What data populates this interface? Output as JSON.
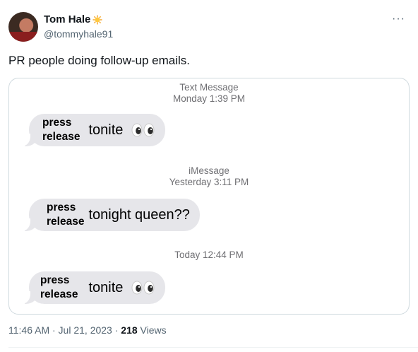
{
  "tweet": {
    "author": {
      "display_name": "Tom Hale",
      "badge_icon": "sun-emoji-icon",
      "handle": "@tommyhale91"
    },
    "more_icon": "more-options-icon",
    "text": "PR people doing follow-up emails.",
    "timestamp": "11:46 AM · Jul 21, 2023 · ",
    "views_count": "218",
    "views_label": " Views"
  },
  "screenshot": {
    "header_top": {
      "line1": "Text Message",
      "line2": "Monday 1:39 PM"
    },
    "header_middle": {
      "line1": "iMessage",
      "line2": "Yesterday 3:11 PM"
    },
    "header_bottom": {
      "line1": "Today 12:44 PM"
    },
    "messages": [
      {
        "sticker_line1": "press",
        "sticker_line2": "release",
        "text": "tonite",
        "emoji": "eyes-emoji-icon"
      },
      {
        "sticker_line1": "press",
        "sticker_line2": "release",
        "text": "tonight queen??"
      },
      {
        "sticker_line1": "press",
        "sticker_line2": "release",
        "text": "tonite",
        "emoji": "eyes-emoji-icon"
      }
    ]
  }
}
